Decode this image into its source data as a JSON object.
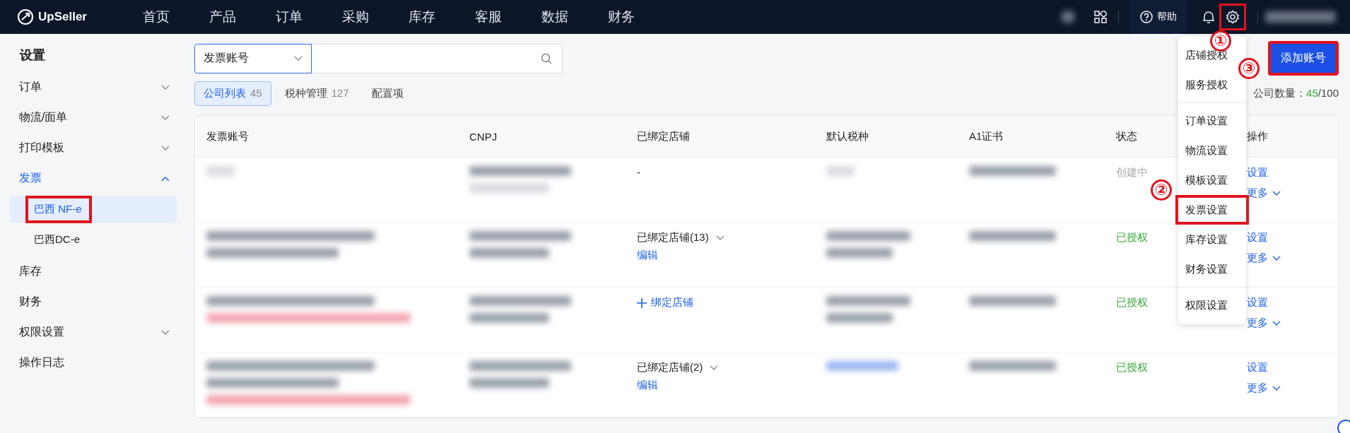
{
  "topbar": {
    "logo": "UpSeller",
    "nav": [
      {
        "label": "首页"
      },
      {
        "label": "产品"
      },
      {
        "label": "订单"
      },
      {
        "label": "采购"
      },
      {
        "label": "库存"
      },
      {
        "label": "客服"
      },
      {
        "label": "数据"
      },
      {
        "label": "财务"
      }
    ],
    "help": "帮助",
    "settings_highlighted": true
  },
  "sidebar": {
    "title": "设置",
    "items": [
      {
        "label": "订单",
        "kind": "group",
        "expanded": false
      },
      {
        "label": "物流/面单",
        "kind": "group",
        "expanded": false
      },
      {
        "label": "打印模板",
        "kind": "group",
        "expanded": false
      },
      {
        "label": "发票",
        "kind": "group",
        "expanded": true,
        "children": [
          {
            "label": "巴西 NF-e",
            "selected": true,
            "highlighted": true
          },
          {
            "label": "巴西DC-e",
            "selected": false,
            "highlighted": false
          }
        ]
      },
      {
        "label": "库存",
        "kind": "link"
      },
      {
        "label": "财务",
        "kind": "link"
      },
      {
        "label": "权限设置",
        "kind": "group",
        "expanded": false
      },
      {
        "label": "操作日志",
        "kind": "link"
      }
    ]
  },
  "search": {
    "field": "发票账号"
  },
  "tabs": [
    {
      "label": "公司列表",
      "count": "45",
      "selected": true
    },
    {
      "label": "税种管理",
      "count": "127",
      "selected": false
    },
    {
      "label": "配置项",
      "selected": false
    }
  ],
  "add_button": {
    "label": "添加账号",
    "highlighted": true
  },
  "company_count": {
    "label": "公司数量：",
    "used": "45",
    "total": "/100"
  },
  "table": {
    "columns": [
      "发票账号",
      "CNPJ",
      "已绑定店铺",
      "默认税种",
      "A1证书",
      "状态",
      "操作"
    ],
    "rows": [
      {
        "account": [
          {
            "kind": "light"
          }
        ],
        "cnpj": [
          {
            "kind": "text"
          },
          {
            "kind": "light"
          }
        ],
        "stores": {
          "kind": "none",
          "text": "-"
        },
        "tax": [
          {
            "kind": "light"
          }
        ],
        "cert": [
          {
            "kind": "text"
          }
        ],
        "status": {
          "kind": "pending",
          "text": "创建中"
        },
        "actions": [
          "设置",
          "更多"
        ]
      },
      {
        "account": [
          {
            "kind": "text"
          },
          {
            "kind": "text"
          }
        ],
        "cnpj": [
          {
            "kind": "text"
          },
          {
            "kind": "text"
          }
        ],
        "stores": {
          "kind": "bound",
          "text": "已绑定店铺(13)",
          "edit": "编辑"
        },
        "tax": [
          {
            "kind": "text"
          },
          {
            "kind": "text"
          }
        ],
        "cert": [
          {
            "kind": "text"
          }
        ],
        "status": {
          "kind": "authorized",
          "text": "已授权"
        },
        "actions": [
          "设置",
          "更多"
        ]
      },
      {
        "account": [
          {
            "kind": "text"
          },
          {
            "kind": "error"
          }
        ],
        "cnpj": [
          {
            "kind": "text"
          },
          {
            "kind": "text"
          }
        ],
        "stores": {
          "kind": "bind",
          "text": "绑定店铺"
        },
        "tax": [
          {
            "kind": "text"
          },
          {
            "kind": "text"
          }
        ],
        "cert": [
          {
            "kind": "text"
          }
        ],
        "status": {
          "kind": "authorized",
          "text": "已授权"
        },
        "actions": [
          "设置",
          "更多"
        ]
      },
      {
        "account": [
          {
            "kind": "text"
          },
          {
            "kind": "text"
          },
          {
            "kind": "error"
          }
        ],
        "cnpj": [
          {
            "kind": "text"
          },
          {
            "kind": "text"
          }
        ],
        "stores": {
          "kind": "bound",
          "text": "已绑定店铺(2)",
          "edit": "编辑"
        },
        "tax": [
          {
            "kind": "link"
          }
        ],
        "cert": [
          {
            "kind": "text"
          }
        ],
        "status": {
          "kind": "authorized",
          "text": "已授权"
        },
        "actions": [
          "设置",
          "更多"
        ]
      }
    ]
  },
  "settings_menu": {
    "groups": [
      [
        {
          "label": "店铺授权",
          "highlighted": false
        },
        {
          "label": "服务授权",
          "highlighted": false
        }
      ],
      [
        {
          "label": "订单设置",
          "highlighted": false
        },
        {
          "label": "物流设置",
          "highlighted": false
        },
        {
          "label": "模板设置",
          "highlighted": false
        },
        {
          "label": "发票设置",
          "highlighted": true
        },
        {
          "label": "库存设置",
          "highlighted": false
        },
        {
          "label": "财务设置",
          "highlighted": false
        }
      ],
      [
        {
          "label": "权限设置",
          "highlighted": false
        }
      ]
    ]
  },
  "annotations": [
    {
      "label": "①",
      "kind": "settings"
    },
    {
      "label": "②",
      "kind": "menu"
    },
    {
      "label": "③",
      "kind": "add"
    }
  ]
}
